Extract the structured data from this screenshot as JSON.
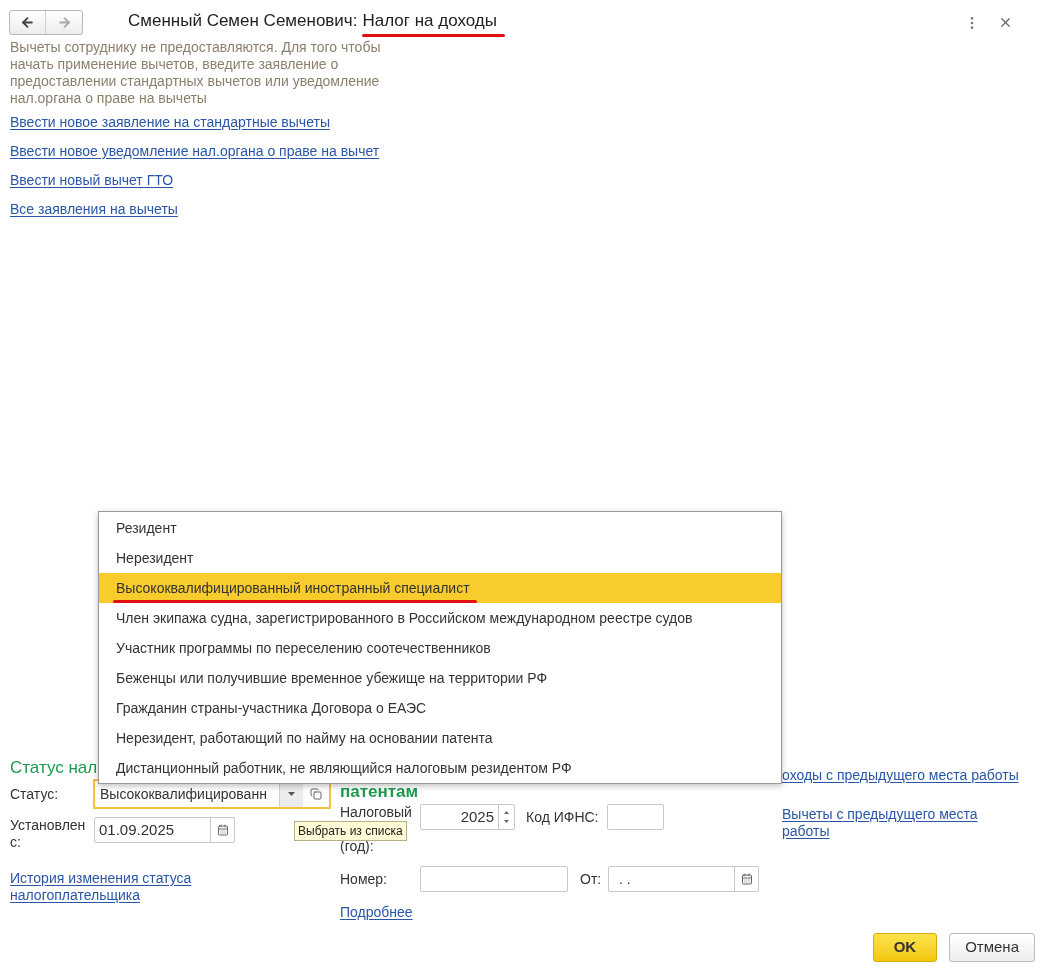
{
  "window": {
    "title_name": "Сменный Семен Семенович:",
    "title_subject": "Налог на доходы",
    "subject_marked": true
  },
  "nav": {
    "back_enabled": true,
    "forward_enabled": false
  },
  "deductions": {
    "notice": "Вычеты сотруднику не предоставляются. Для того чтобы начать применение вычетов, введите заявление о предоставлении стандартных вычетов или уведомление нал.органа о праве на вычеты",
    "links": [
      "Ввести новое заявление на стандартные вычеты",
      "Ввести новое уведомление нал.органа о праве на вычет",
      "Ввести новый вычет ГТО",
      "Все заявления на вычеты"
    ]
  },
  "tax_status": {
    "heading": "Статус нал",
    "status_label": "Статус:",
    "status_value": "Высококвалифицированн",
    "focused": true,
    "established_label": "Установлен с:",
    "established_value": "01.09.2025",
    "history_link": "История изменения статуса налогоплательщика"
  },
  "status_dropdown": {
    "items": [
      {
        "label": "Резидент",
        "selected": false,
        "marked": false
      },
      {
        "label": "Нерезидент",
        "selected": false,
        "marked": false
      },
      {
        "label": "Высококвалифицированный иностранный специалист",
        "selected": true,
        "marked": true
      },
      {
        "label": "Член экипажа судна, зарегистрированного в Российском международном реестре судов",
        "selected": false,
        "marked": false
      },
      {
        "label": "Участник программы по переселению соотечественников",
        "selected": false,
        "marked": false
      },
      {
        "label": "Беженцы или получившие временное убежище на территории РФ",
        "selected": false,
        "marked": false
      },
      {
        "label": "Гражданин страны-участника Договора о ЕАЭС",
        "selected": false,
        "marked": false
      },
      {
        "label": "Нерезидент, работающий по найму на основании патента",
        "selected": false,
        "marked": false
      },
      {
        "label": "Дистанционный работник, не являющийся налоговым резидентом РФ",
        "selected": false,
        "marked": false
      }
    ]
  },
  "tooltip": "Выбрать из списка",
  "patent": {
    "heading": "патентам",
    "period_label_lines": [
      "Налоговый",
      "(год):"
    ],
    "period_value": "2025",
    "ifns_label": "Код ИФНС:",
    "number_label": "Номер:",
    "from_label": "От:",
    "from_value": ". .",
    "more_link": "Подробнее"
  },
  "previous_job": {
    "links": [
      "оходы с предыдущего места работы",
      "Вычеты с предыдущего места работы"
    ]
  },
  "buttons": [
    {
      "label": "OK",
      "kind": "primary"
    },
    {
      "label": "Отмена",
      "kind": "secondary"
    }
  ]
}
